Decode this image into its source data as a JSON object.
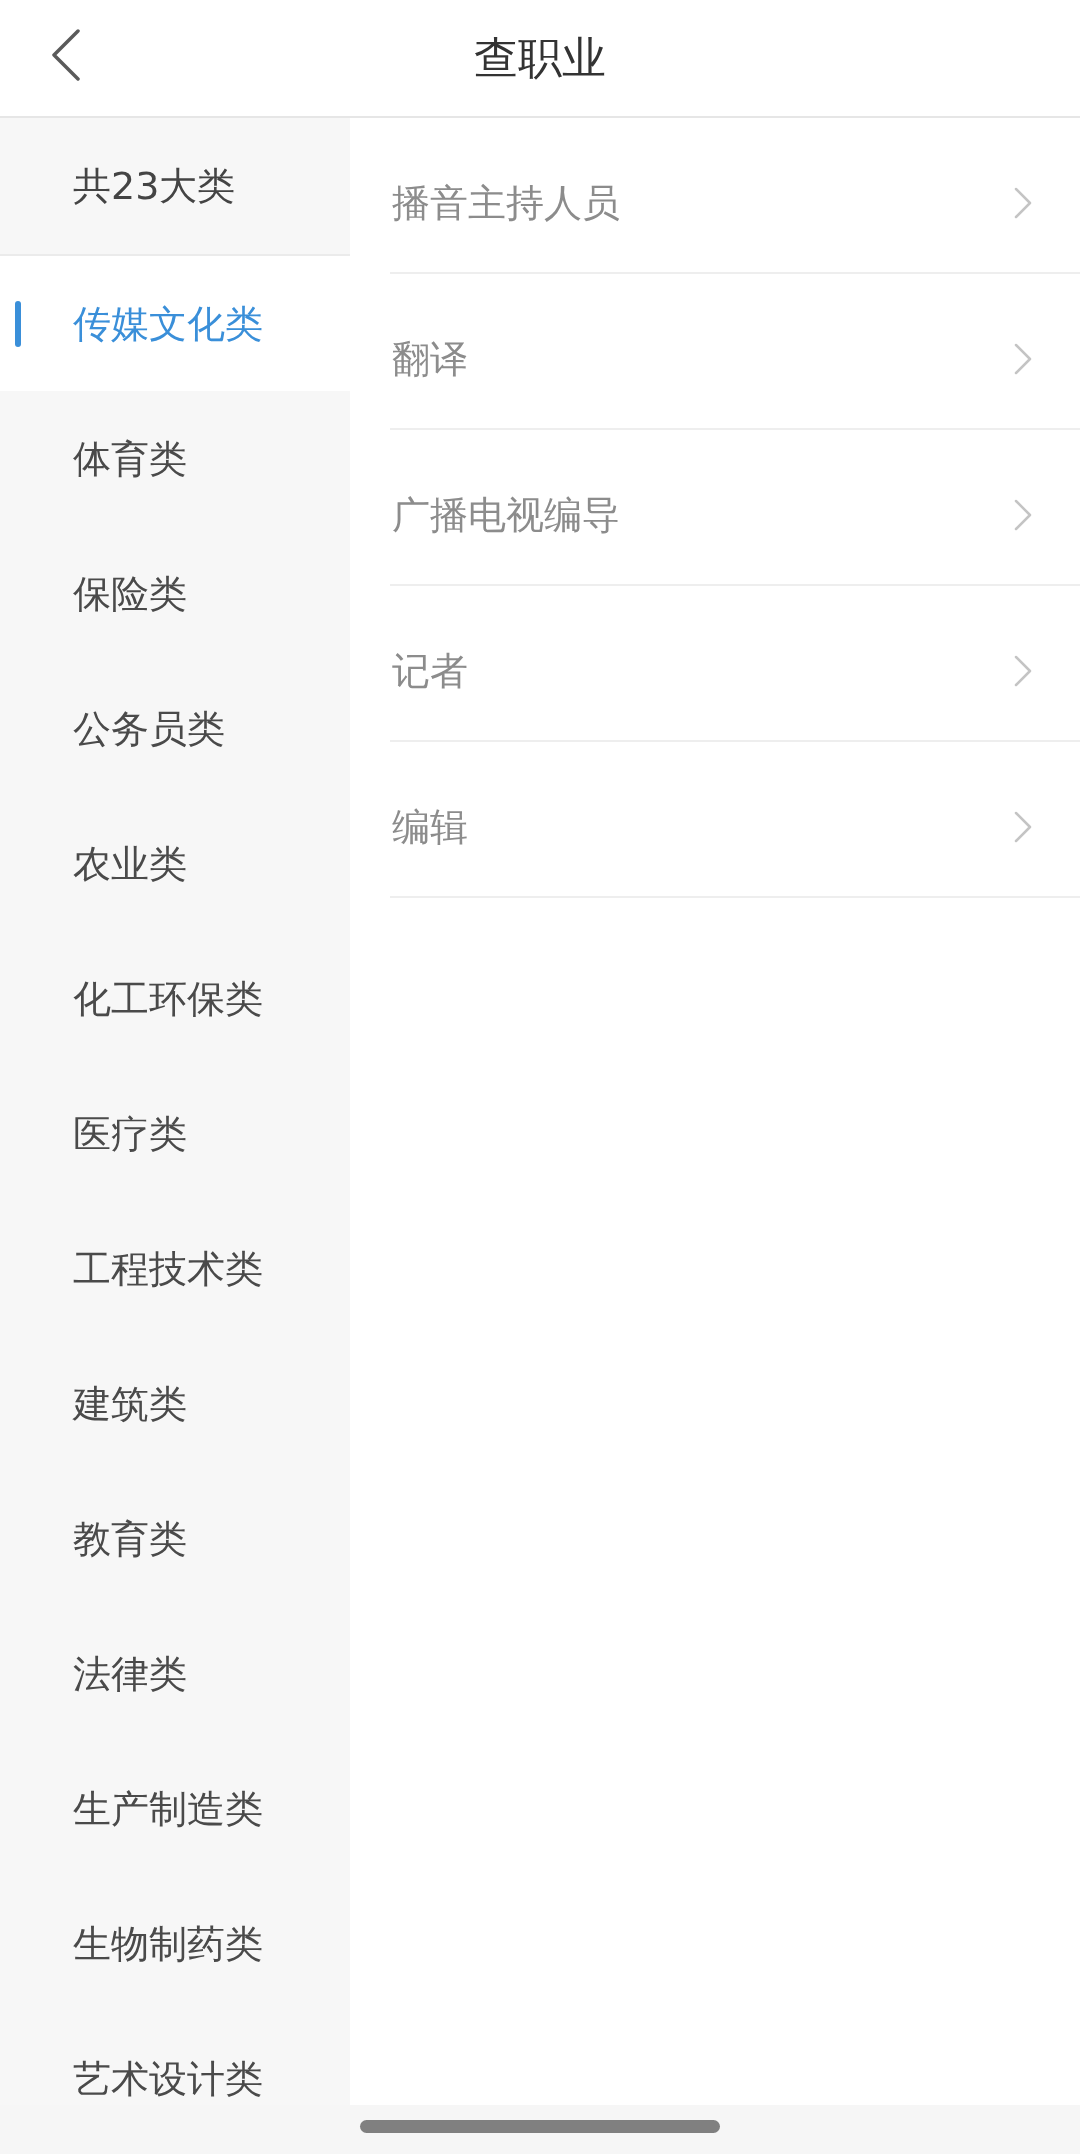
{
  "header": {
    "title": "查职业"
  },
  "sidebar": {
    "summary": "共23大类",
    "categories": [
      {
        "label": "传媒文化类",
        "selected": true
      },
      {
        "label": "体育类",
        "selected": false
      },
      {
        "label": "保险类",
        "selected": false
      },
      {
        "label": "公务员类",
        "selected": false
      },
      {
        "label": "农业类",
        "selected": false
      },
      {
        "label": "化工环保类",
        "selected": false
      },
      {
        "label": "医疗类",
        "selected": false
      },
      {
        "label": "工程技术类",
        "selected": false
      },
      {
        "label": "建筑类",
        "selected": false
      },
      {
        "label": "教育类",
        "selected": false
      },
      {
        "label": "法律类",
        "selected": false
      },
      {
        "label": "生产制造类",
        "selected": false
      },
      {
        "label": "生物制药类",
        "selected": false
      },
      {
        "label": "艺术设计类",
        "selected": false
      }
    ]
  },
  "occupations": [
    {
      "label": "播音主持人员"
    },
    {
      "label": "翻译"
    },
    {
      "label": "广播电视编导"
    },
    {
      "label": "记者"
    },
    {
      "label": "编辑"
    }
  ]
}
